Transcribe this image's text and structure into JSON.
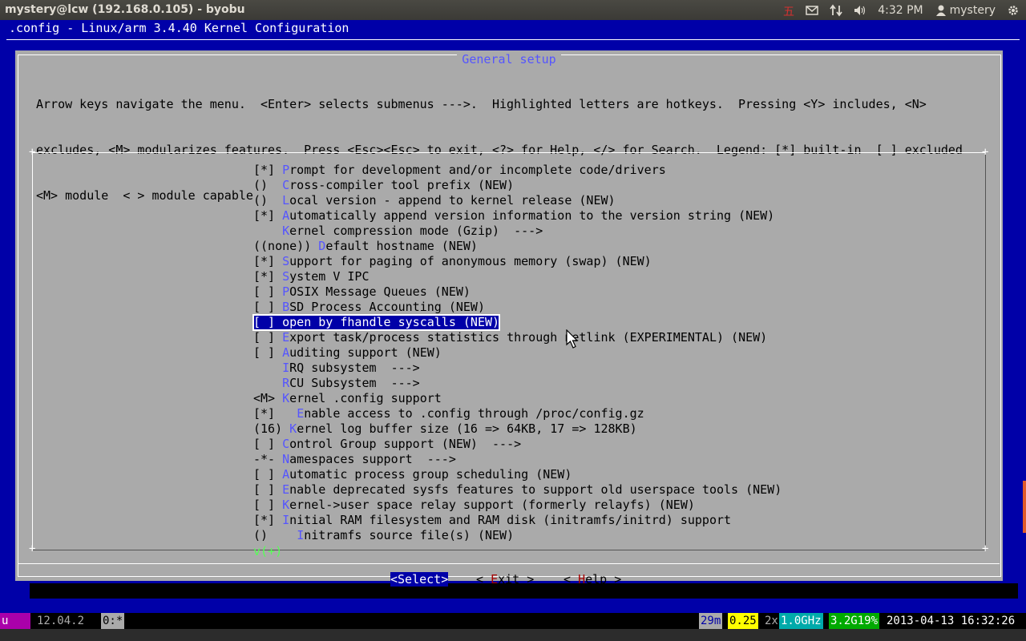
{
  "window": {
    "title": "mystery@lcw (192.168.0.105) - byobu"
  },
  "panel": {
    "clock": "4:32 PM",
    "user": "mystery"
  },
  "terminal": {
    "header": ".config - Linux/arm 3.4.40 Kernel Configuration"
  },
  "dialog": {
    "title": "General setup",
    "help": [
      "Arrow keys navigate the menu.  <Enter> selects submenus --->.  Highlighted letters are hotkeys.  Pressing <Y> includes, <N>",
      "excludes, <M> modularizes features.  Press <Esc><Esc> to exit, <?> for Help, </> for Search.  Legend: [*] built-in  [ ] excluded",
      "<M> module  < > module capable"
    ],
    "items": [
      {
        "pre": "[*] ",
        "hk": "P",
        "rest": "rompt for development and/or incomplete code/drivers"
      },
      {
        "pre": "()  ",
        "hk": "C",
        "rest": "ross-compiler tool prefix (NEW)"
      },
      {
        "pre": "()  ",
        "hk": "L",
        "rest": "ocal version - append to kernel release (NEW)"
      },
      {
        "pre": "[*] ",
        "hk": "A",
        "rest": "utomatically append version information to the version string (NEW)"
      },
      {
        "pre": "    ",
        "hk": "K",
        "rest": "ernel compression mode (Gzip)  --->"
      },
      {
        "pre": "((none)) ",
        "hk": "D",
        "rest": "efault hostname (NEW)"
      },
      {
        "pre": "[*] ",
        "hk": "S",
        "rest": "upport for paging of anonymous memory (swap) (NEW)"
      },
      {
        "pre": "[*] ",
        "hk": "S",
        "rest": "ystem V IPC"
      },
      {
        "pre": "[ ] ",
        "hk": "P",
        "rest": "OSIX Message Queues (NEW)"
      },
      {
        "pre": "[ ] ",
        "hk": "B",
        "rest": "SD Process Accounting (NEW)"
      },
      {
        "pre": "[ ] ",
        "hk": "o",
        "rest": "pen by fhandle syscalls (NEW)",
        "selected": true
      },
      {
        "pre": "[ ] ",
        "hk": "E",
        "rest": "xport task/process statistics through netlink (EXPERIMENTAL) (NEW)"
      },
      {
        "pre": "[ ] ",
        "hk": "A",
        "rest": "uditing support (NEW)"
      },
      {
        "pre": "    ",
        "hk": "I",
        "rest": "RQ subsystem  --->"
      },
      {
        "pre": "    ",
        "hk": "R",
        "rest": "CU Subsystem  --->"
      },
      {
        "pre": "<M> ",
        "hk": "K",
        "rest": "ernel .config support"
      },
      {
        "pre": "[*]   ",
        "hk": "E",
        "rest": "nable access to .config through /proc/config.gz"
      },
      {
        "pre": "(16) ",
        "hk": "K",
        "rest": "ernel log buffer size (16 => 64KB, 17 => 128KB)"
      },
      {
        "pre": "[ ] ",
        "hk": "C",
        "rest": "ontrol Group support (NEW)  --->"
      },
      {
        "pre": "-*- ",
        "hk": "N",
        "rest": "amespaces support  --->"
      },
      {
        "pre": "[ ] ",
        "hk": "A",
        "rest": "utomatic process group scheduling (NEW)"
      },
      {
        "pre": "[ ] ",
        "hk": "E",
        "rest": "nable deprecated sysfs features to support old userspace tools (NEW)"
      },
      {
        "pre": "[ ] ",
        "hk": "K",
        "rest": "ernel->user space relay support (formerly relayfs) (NEW)"
      },
      {
        "pre": "[*] ",
        "hk": "I",
        "rest": "nitial RAM filesystem and RAM disk (initramfs/initrd) support"
      },
      {
        "pre": "()    ",
        "hk": "I",
        "rest": "nitramfs source file(s) (NEW)"
      }
    ],
    "more_indicator": "v(+)",
    "buttons": {
      "select": "<Select>",
      "exit_pre": "< ",
      "exit_hk": "E",
      "exit_rest": "xit >",
      "help_pre": "< ",
      "help_hk": "H",
      "help_rest": "elp >"
    }
  },
  "status_bar": {
    "logo": "u",
    "release": "12.04.2",
    "window": "0:*",
    "uptime": "29m",
    "load": "0.25",
    "cpu_count": "2x",
    "cpu_freq": "1.0GHz",
    "memory": "3.2G19%",
    "datetime": "2013-04-13 16:32:26"
  },
  "colors": {
    "terminal_bg": "#0000a8",
    "dialog_bg": "#aaaaaa",
    "hotkey": "#5555ff",
    "button_hotkey": "#a80000",
    "load_bg": "#ffff00",
    "cpu_bg": "#00aaaa",
    "mem_bg": "#00aa00"
  }
}
